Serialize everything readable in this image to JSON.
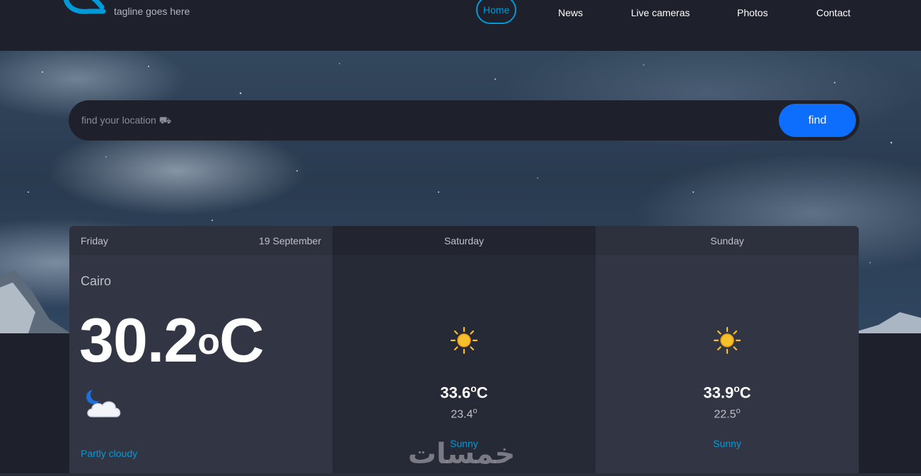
{
  "header": {
    "tagline": "tagline goes here",
    "nav": [
      {
        "label": "Home",
        "active": true
      },
      {
        "label": "News",
        "active": false
      },
      {
        "label": "Live cameras",
        "active": false
      },
      {
        "label": "Photos",
        "active": false
      },
      {
        "label": "Contact",
        "active": false
      }
    ]
  },
  "search": {
    "placeholder": "find your location ⛟",
    "button_label": "find"
  },
  "forecast": {
    "today": {
      "day": "Friday",
      "date": "19 September",
      "city": "Cairo",
      "temp_value": "30.2",
      "temp_degree": "o",
      "temp_unit": "C",
      "icon": "moon-cloud-icon",
      "condition": "Partly cloudy"
    },
    "days": [
      {
        "day": "Saturday",
        "max_value": "33.6",
        "max_degree": "o",
        "max_unit": "C",
        "min_value": "23.4",
        "min_degree": "o",
        "icon": "sun-icon",
        "condition": "Sunny"
      },
      {
        "day": "Sunday",
        "max_value": "33.9",
        "max_degree": "o",
        "max_unit": "C",
        "min_value": "22.5",
        "min_degree": "o",
        "icon": "sun-icon",
        "condition": "Sunny"
      }
    ]
  },
  "watermark": "خمسات",
  "colors": {
    "accent": "#009ad8",
    "button": "#0d6efd",
    "background": "#1e202b",
    "card": "#323544",
    "sun": "#f6c02b"
  }
}
